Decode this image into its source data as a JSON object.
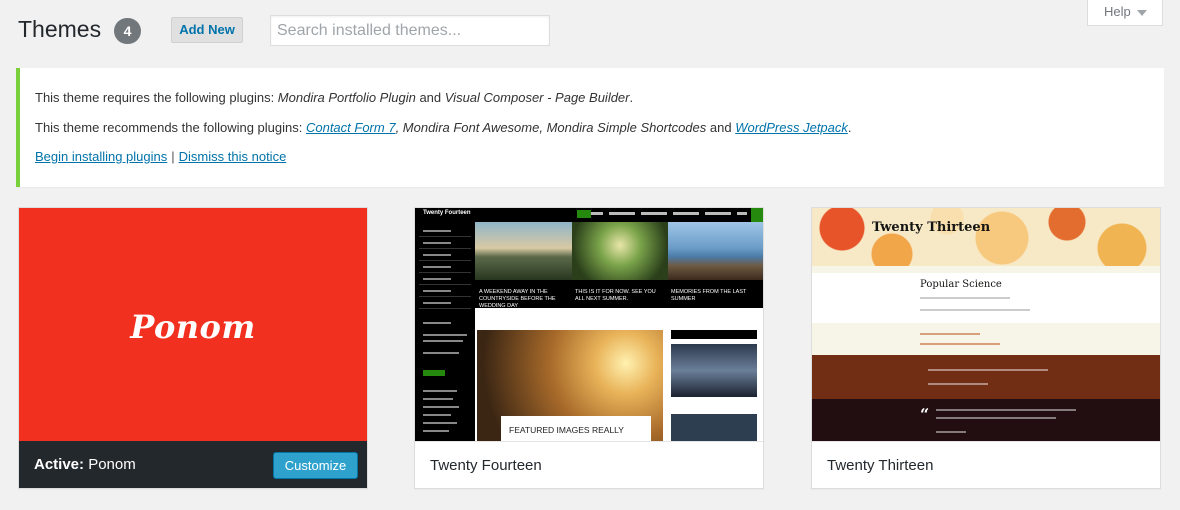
{
  "header": {
    "title": "Themes",
    "count": "4",
    "add_new_label": "Add New",
    "search_placeholder": "Search installed themes...",
    "help_label": "Help"
  },
  "notice": {
    "line1_prefix": "This theme requires the following plugins: ",
    "line1_plugin1": "Mondira Portfolio Plugin",
    "line1_and": " and ",
    "line1_plugin2": "Visual Composer - Page Builder",
    "line1_end": ".",
    "line2_prefix": "This theme recommends the following plugins: ",
    "line2_link1": "Contact Form 7",
    "line2_mid": ", Mondira Font Awesome, Mondira Simple Shortcodes",
    "line2_and": " and ",
    "line2_link2": "WordPress Jetpack",
    "line2_end": ".",
    "begin_installing": "Begin installing plugins",
    "separator": "|",
    "dismiss": "Dismiss this notice",
    "accent_color": "#7ad03a"
  },
  "themes": [
    {
      "active_prefix": "Active:",
      "name": "Ponom",
      "logo_text": "Ponom",
      "customize_label": "Customize",
      "screenshot_color": "#f2301f"
    },
    {
      "name": "Twenty Fourteen",
      "preview": {
        "site_title": "Twenty Fourteen",
        "caption1": "A WEEKEND AWAY IN THE COUNTRYSIDE BEFORE THE WEDDING DAY",
        "caption2": "THIS IS IT FOR NOW. SEE YOU ALL NEXT SUMMER.",
        "caption3": "MEMORIES FROM THE LAST SUMMER",
        "featured_heading": "FEATURED IMAGES REALLY"
      }
    },
    {
      "name": "Twenty Thirteen",
      "preview": {
        "site_title": "Twenty Thirteen",
        "post_title": "Popular Science",
        "quote_mark": "“"
      }
    }
  ]
}
